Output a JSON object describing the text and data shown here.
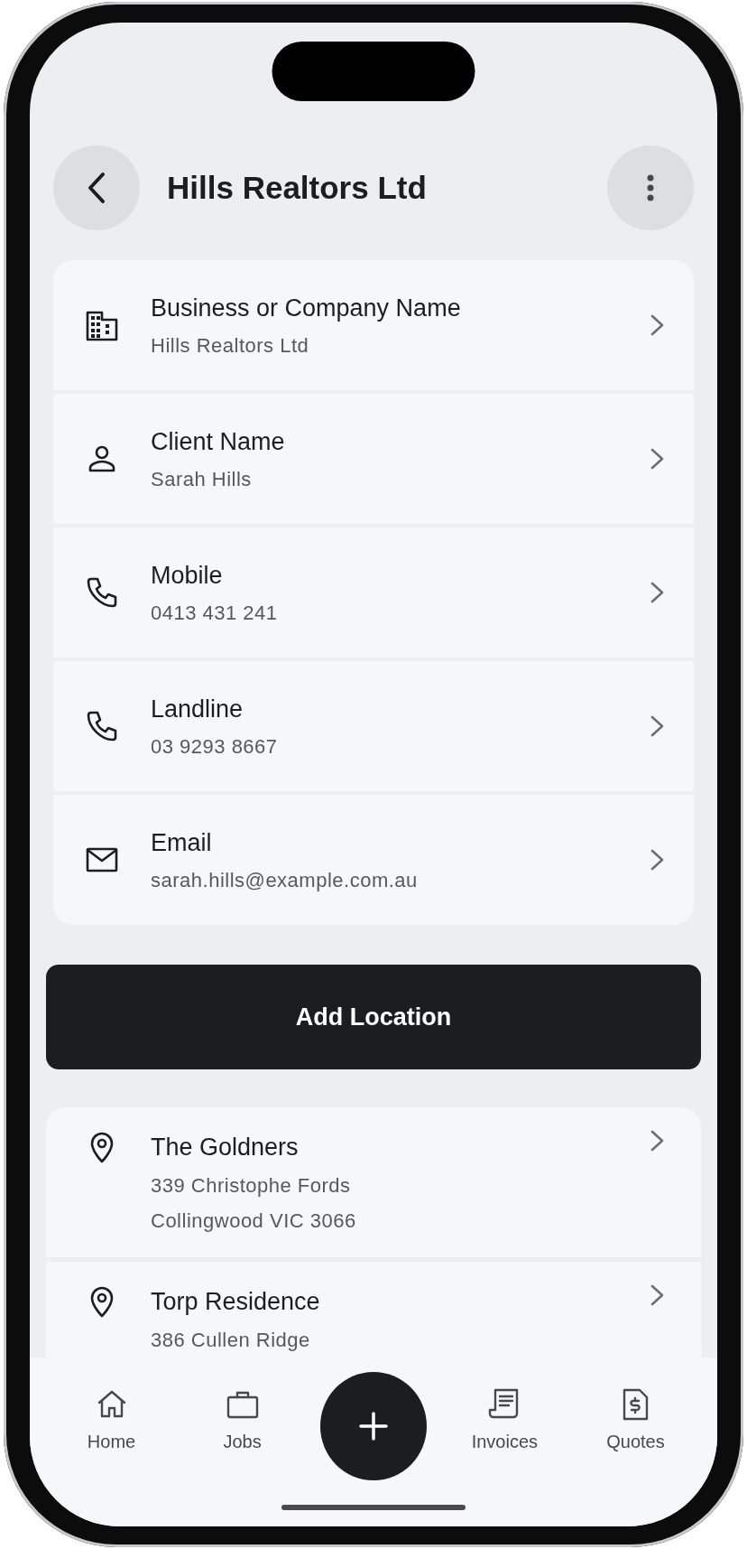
{
  "header": {
    "title": "Hills Realtors Ltd"
  },
  "details": [
    {
      "kind": "business",
      "label": "Business or Company Name",
      "value": "Hills Realtors Ltd"
    },
    {
      "kind": "person",
      "label": "Client Name",
      "value": "Sarah Hills"
    },
    {
      "kind": "phone",
      "label": "Mobile",
      "value": "0413 431 241"
    },
    {
      "kind": "phone",
      "label": "Landline",
      "value": "03 9293 8667"
    },
    {
      "kind": "email",
      "label": "Email",
      "value": "sarah.hills@example.com.au"
    }
  ],
  "add_button": "Add Location",
  "locations": [
    {
      "name": "The Goldners",
      "lines": [
        "339 Christophe Fords",
        "Collingwood VIC 3066"
      ]
    },
    {
      "name": "Torp Residence",
      "lines": [
        "386 Cullen Ridge"
      ]
    }
  ],
  "nav": [
    {
      "kind": "home",
      "label": "Home"
    },
    {
      "kind": "jobs",
      "label": "Jobs"
    },
    {
      "kind": "add"
    },
    {
      "kind": "invoices",
      "label": "Invoices"
    },
    {
      "kind": "quotes",
      "label": "Quotes"
    }
  ]
}
